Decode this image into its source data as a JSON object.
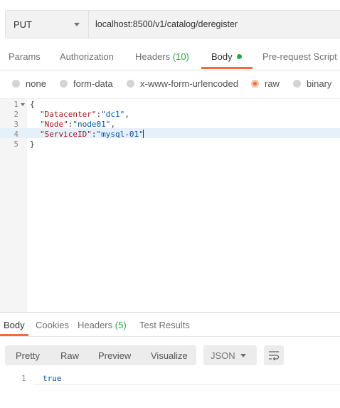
{
  "request": {
    "method": "PUT",
    "url": "localhost:8500/v1/catalog/deregister"
  },
  "request_tabs": {
    "params": "Params",
    "authorization": "Authorization",
    "headers": "Headers",
    "headers_count": "(10)",
    "body": "Body",
    "prerequest": "Pre-request Script"
  },
  "body_types": {
    "none": "none",
    "form_data": "form-data",
    "urlencoded": "x-www-form-urlencoded",
    "raw": "raw",
    "binary": "binary",
    "selected": "raw"
  },
  "editor": {
    "line_numbers": [
      "1",
      "2",
      "3",
      "4",
      "5"
    ],
    "line1": "{",
    "line2_key": "\"Datacenter\"",
    "line2_sep": ":",
    "line2_val": "\"dc1\"",
    "line2_end": ",",
    "line3_key": "\"Node\"",
    "line3_sep": ":",
    "line3_val": "\"node01\"",
    "line3_end": ",",
    "line4_key": "\"ServiceID\"",
    "line4_sep": ":",
    "line4_val": "\"mysql-01\"",
    "line5": "}"
  },
  "response_tabs": {
    "body": "Body",
    "cookies": "Cookies",
    "headers": "Headers",
    "headers_count": "(5)",
    "test_results": "Test Results"
  },
  "response_toolbar": {
    "pretty": "Pretty",
    "raw": "Raw",
    "preview": "Preview",
    "visualize": "Visualize",
    "format": "JSON"
  },
  "response_body": {
    "line_number": "1",
    "value": "true"
  },
  "colors": {
    "accent": "#f26b3a",
    "count_green": "#28a745"
  },
  "icons": {
    "method_dropdown": "chevron-down-icon",
    "format_dropdown": "chevron-down-icon",
    "wrap": "wrap-lines-icon",
    "fold": "fold-arrow-icon"
  }
}
